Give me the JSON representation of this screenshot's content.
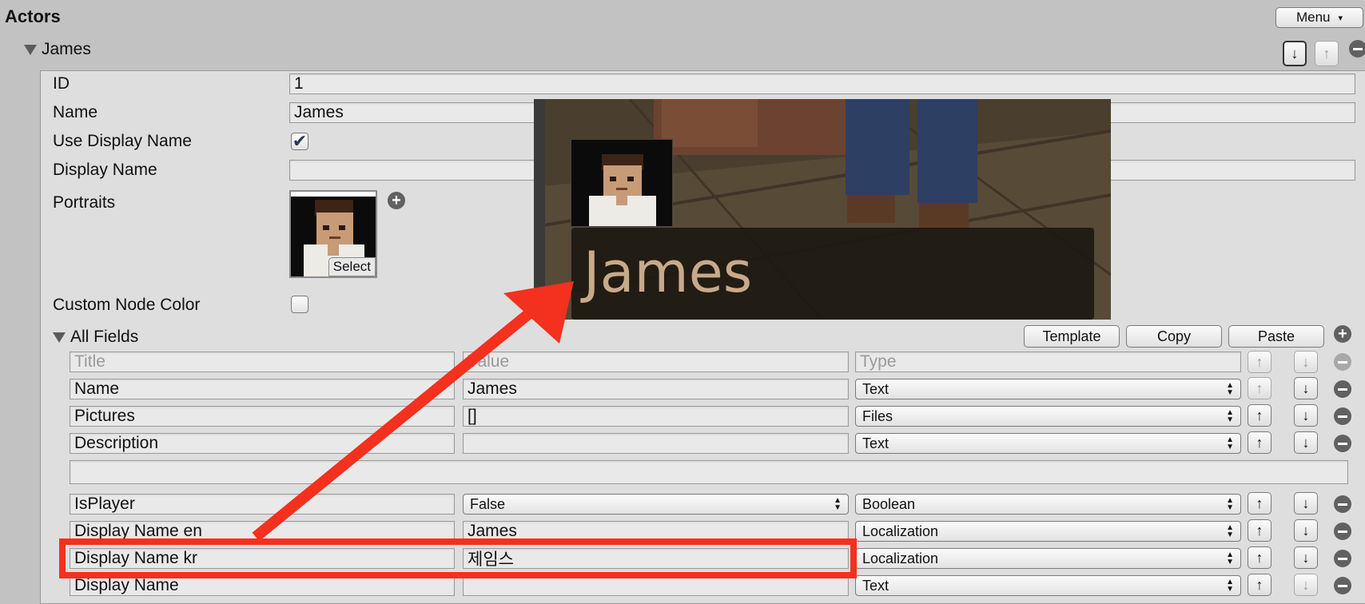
{
  "header": {
    "title": "Actors",
    "menu_label": "Menu",
    "menu_caret": "▾"
  },
  "actor": {
    "name": "James",
    "move_down_icon": "↓",
    "move_up_icon": "↑"
  },
  "properties": {
    "id_label": "ID",
    "id_value": "1",
    "name_label": "Name",
    "name_value": "James",
    "use_display_name_label": "Use Display Name",
    "use_display_name_checked": true,
    "display_name_label": "Display Name",
    "display_name_value": "",
    "portraits_label": "Portraits",
    "portrait_select_label": "Select",
    "custom_node_color_label": "Custom Node Color",
    "custom_node_color_checked": false
  },
  "all_fields": {
    "label": "All Fields",
    "buttons": {
      "template": "Template",
      "copy": "Copy",
      "paste": "Paste"
    },
    "headers": {
      "title": "Title",
      "value": "Value",
      "type": "Type"
    },
    "rows": [
      {
        "title": "Name",
        "value": "James",
        "value_kind": "text",
        "type": "Text",
        "up_enabled": false,
        "down_enabled": true
      },
      {
        "title": "Pictures",
        "value": "[]",
        "value_kind": "text",
        "type": "Files",
        "up_enabled": true,
        "down_enabled": true
      },
      {
        "title": "Description",
        "value": "",
        "value_kind": "text",
        "type": "Text",
        "up_enabled": true,
        "down_enabled": true
      },
      {
        "title": "IsPlayer",
        "value": "False",
        "value_kind": "select",
        "type": "Boolean",
        "up_enabled": true,
        "down_enabled": true
      },
      {
        "title": "Display Name en",
        "value": "James",
        "value_kind": "text",
        "type": "Localization",
        "up_enabled": true,
        "down_enabled": true
      },
      {
        "title": "Display Name kr",
        "value": "제임스",
        "value_kind": "text",
        "type": "Localization",
        "up_enabled": true,
        "down_enabled": true
      },
      {
        "title": "Display Name",
        "value": "",
        "value_kind": "text",
        "type": "Text",
        "up_enabled": true,
        "down_enabled": false
      }
    ]
  },
  "preview": {
    "speaker_name": "James"
  },
  "colors": {
    "highlight_red": "#f4301e",
    "panel_bg": "#dedede",
    "window_bg": "#c2c2c2"
  }
}
